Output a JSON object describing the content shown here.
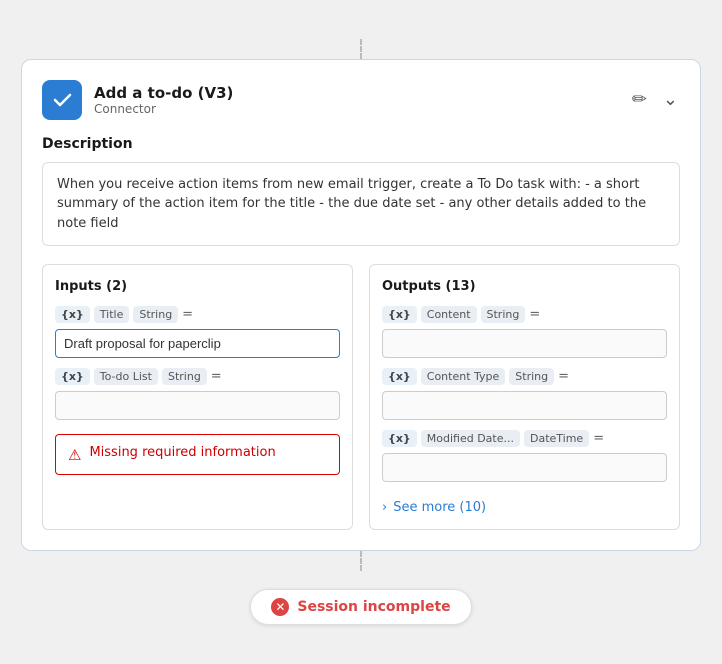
{
  "header": {
    "title": "Add a to-do (V3)",
    "subtitle": "Connector",
    "edit_icon": "✏",
    "collapse_icon": "⌄"
  },
  "description": {
    "label": "Description",
    "text": "When you receive action items from new email trigger, create a To Do task with: - a short summary of the action item for the title - the due date set - any other details added to the note field"
  },
  "inputs": {
    "title": "Inputs (2)",
    "fields": [
      {
        "var": "{x}",
        "name": "Title",
        "type": "String",
        "eq": "=",
        "value": "Draft proposal for paperclip"
      },
      {
        "var": "{x}",
        "name": "To-do List",
        "type": "String",
        "eq": "=",
        "value": ""
      }
    ],
    "error": {
      "icon": "⚠",
      "message": "Missing required information"
    }
  },
  "outputs": {
    "title": "Outputs (13)",
    "fields": [
      {
        "var": "{x}",
        "name": "Content",
        "type": "String",
        "eq": "=",
        "value": ""
      },
      {
        "var": "{x}",
        "name": "Content Type",
        "type": "String",
        "eq": "=",
        "value": ""
      },
      {
        "var": "{x}",
        "name": "Modified Date...",
        "type": "DateTime",
        "eq": "=",
        "value": ""
      }
    ],
    "see_more": "See more (10)"
  },
  "session": {
    "error_icon": "✕",
    "message": "Session incomplete"
  }
}
